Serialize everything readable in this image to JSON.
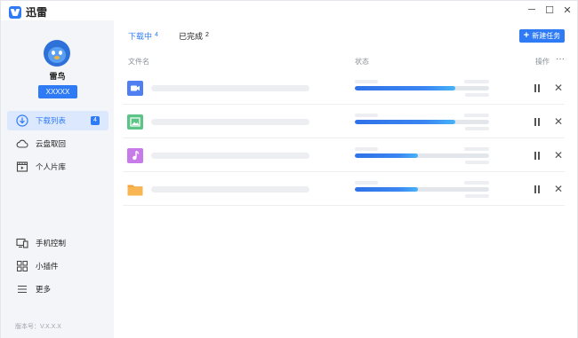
{
  "app": {
    "title": "迅雷",
    "brand_color": "#2f7bf5"
  },
  "window_controls": {
    "minimize": "─",
    "maximize": "☐",
    "close": "✕"
  },
  "user": {
    "name": "雷鸟",
    "badge": "XXXXX"
  },
  "sidebar": {
    "items": [
      {
        "label": "下载列表",
        "icon": "download-icon",
        "count": "4",
        "active": true
      },
      {
        "label": "云盘取回",
        "icon": "cloud-icon"
      },
      {
        "label": "个人片库",
        "icon": "film-icon"
      },
      {
        "label": "手机控制",
        "icon": "phone-icon"
      },
      {
        "label": "小插件",
        "icon": "plugin-grid-icon"
      },
      {
        "label": "更多",
        "icon": "menu-icon"
      }
    ],
    "version": "版本号：V.X.X.X"
  },
  "tabs": [
    {
      "label": "下载中",
      "count": "4",
      "active": true
    },
    {
      "label": "已完成",
      "count": "2"
    }
  ],
  "toolbar": {
    "new_task_label": "新建任务",
    "new_task_icon": "plus-icon"
  },
  "columns": {
    "filename": "文件名",
    "status": "状态",
    "actions": "操作",
    "more": "···"
  },
  "rows": [
    {
      "type": "video",
      "icon": "video-file-icon",
      "color": "#4f7ff0",
      "progress": 0.75
    },
    {
      "type": "image",
      "icon": "image-file-icon",
      "color": "#5cc487",
      "progress": 0.75
    },
    {
      "type": "music",
      "icon": "music-file-icon",
      "color": "#c77be8",
      "progress": 0.47
    },
    {
      "type": "folder",
      "icon": "folder-icon",
      "color": "#f5a43f",
      "progress": 0.47
    }
  ],
  "row_actions": {
    "pause": "pause-icon",
    "delete": "✕"
  }
}
